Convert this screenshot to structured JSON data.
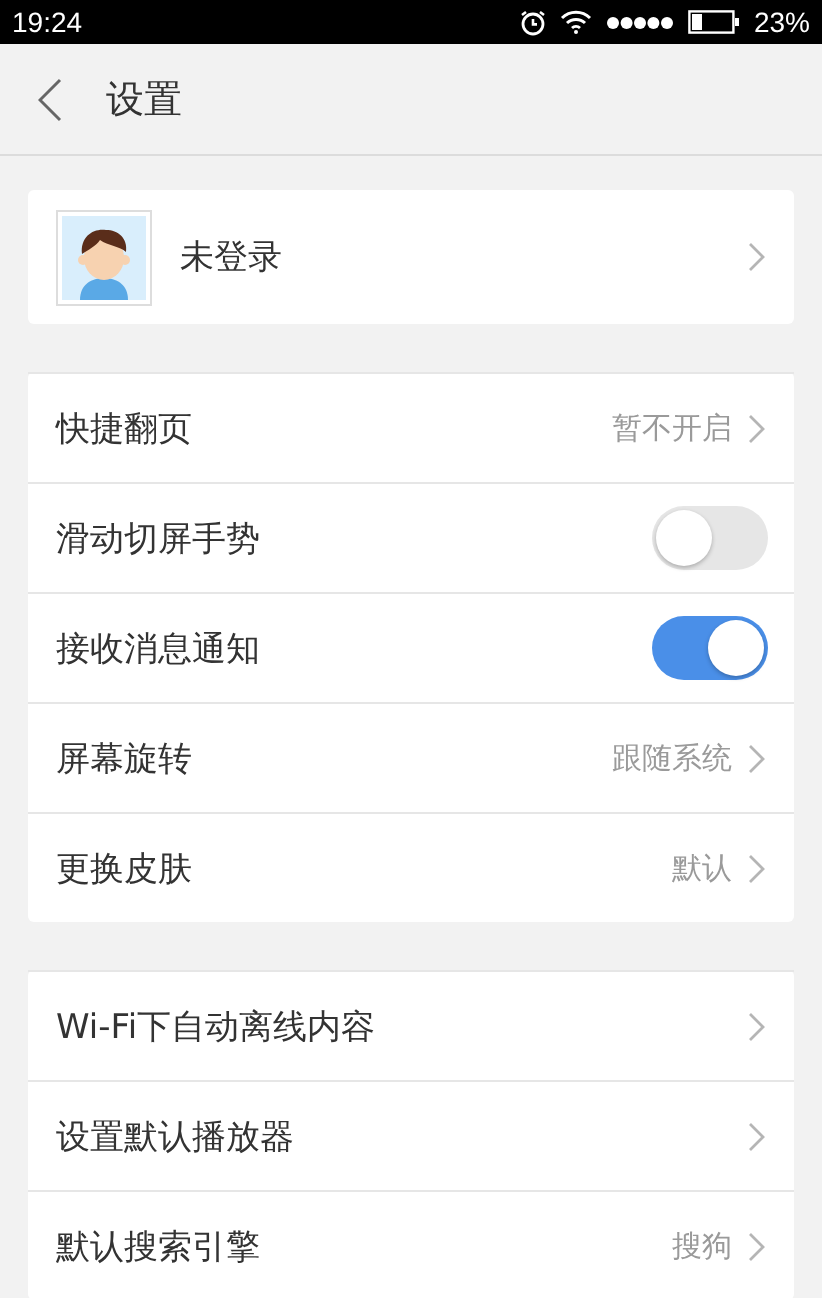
{
  "status_bar": {
    "time": "19:24",
    "battery_text": "23%"
  },
  "header": {
    "title": "设置"
  },
  "account": {
    "name": "未登录"
  },
  "groups": [
    {
      "rows": [
        {
          "kind": "link",
          "label": "快捷翻页",
          "value": "暂不开启"
        },
        {
          "kind": "toggle",
          "label": "滑动切屏手势",
          "on": false
        },
        {
          "kind": "toggle",
          "label": "接收消息通知",
          "on": true
        },
        {
          "kind": "link",
          "label": "屏幕旋转",
          "value": "跟随系统"
        },
        {
          "kind": "link",
          "label": "更换皮肤",
          "value": "默认"
        }
      ]
    },
    {
      "rows": [
        {
          "kind": "link",
          "label": "Wi-Fi下自动离线内容"
        },
        {
          "kind": "link",
          "label": "设置默认播放器"
        },
        {
          "kind": "link",
          "label": "默认搜索引擎",
          "value": "搜狗"
        }
      ]
    }
  ]
}
